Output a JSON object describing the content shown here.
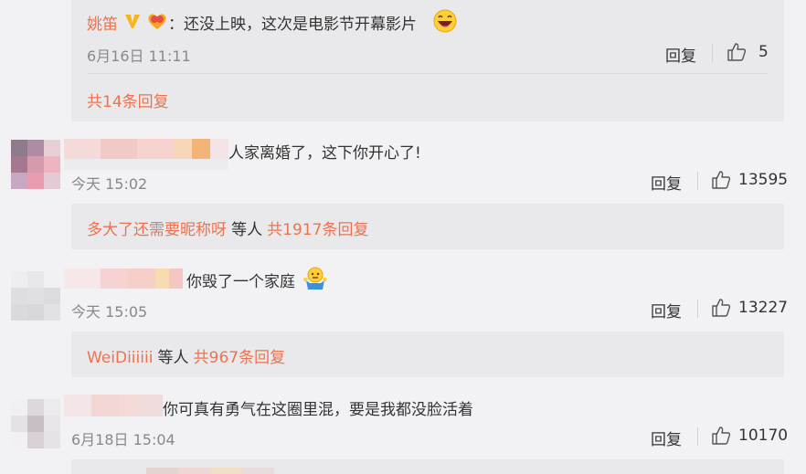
{
  "colors": {
    "accent": "#eb7350",
    "text": "#333333",
    "muted": "#888888",
    "background": "#f2f2f5",
    "reply_panel": "#e9e9ec"
  },
  "top_reply": {
    "author": "姚笛",
    "text": "：还没上映，这次是电影节开幕影片",
    "time": "6月16日 11:11",
    "reply_label": "回复",
    "likes": "5",
    "summary": "共14条回复"
  },
  "comments": [
    {
      "text": "人家离婚了，这下你开心了!",
      "time": "今天 15:02",
      "reply_label": "回复",
      "likes": "13595",
      "replies": {
        "names": "多大了还需要昵称呀",
        "connector": "等人",
        "count": "共1917条回复"
      }
    },
    {
      "text": "你毁了一个家庭",
      "time": "今天 15:05",
      "reply_label": "回复",
      "likes": "13227",
      "replies": {
        "names": "WeiDiiiiii",
        "connector": "等人",
        "count": "共967条回复"
      }
    },
    {
      "text": "你可真有勇气在这圈里混，要是我都没脸活着",
      "time": "6月18日 15:04",
      "reply_label": "回复",
      "likes": "10170"
    }
  ],
  "icons": {
    "vip": "verified-v-icon",
    "badge": "fan-badge-icon",
    "laugh": "laughing-emoji-icon",
    "shrug": "shrug-emoji-icon",
    "like": "thumb-up-icon"
  }
}
